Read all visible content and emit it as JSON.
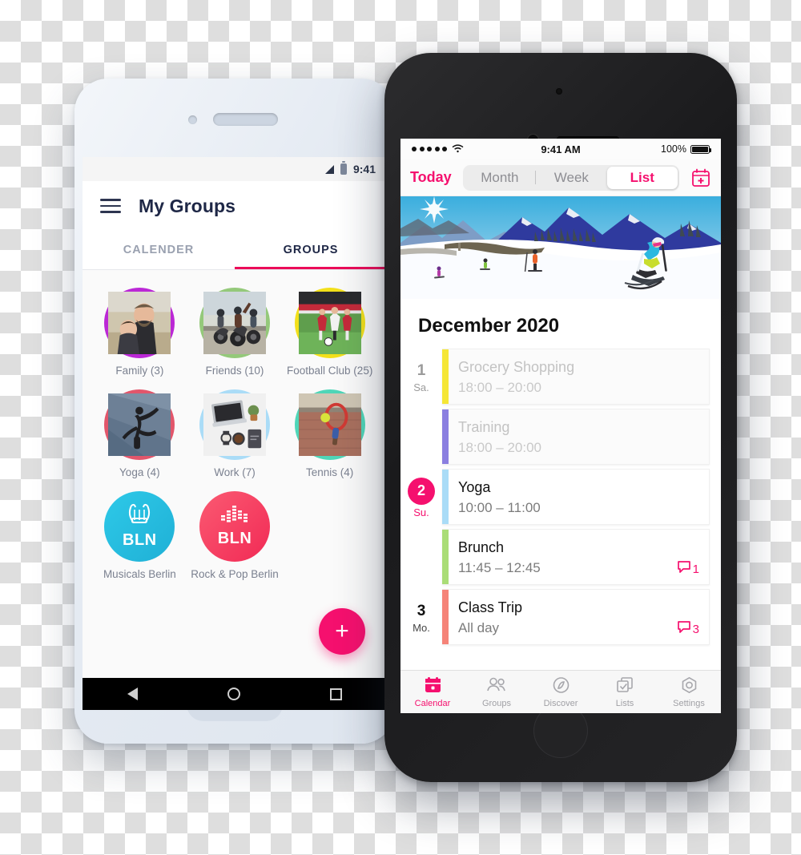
{
  "android": {
    "status": {
      "time": "9:41"
    },
    "header": {
      "title": "My Groups",
      "menu_icon": "hamburger-menu-icon"
    },
    "tabs": [
      {
        "label": "CALENDER",
        "active": false
      },
      {
        "label": "GROUPS",
        "active": true
      }
    ],
    "groups": [
      {
        "label": "Family (3)",
        "ring": "#bb28d6",
        "kind": "photo",
        "photo": "family-portrait"
      },
      {
        "label": "Friends (10)",
        "ring": "#94c97a",
        "kind": "photo",
        "photo": "motorcycle-riders"
      },
      {
        "label": "Football Club (25)",
        "ring": "#f3e01a",
        "kind": "photo",
        "photo": "soccer-match"
      },
      {
        "label": "Yoga (4)",
        "ring": "#e2566b",
        "kind": "photo",
        "photo": "yoga-pose"
      },
      {
        "label": "Work (7)",
        "ring": "#aadcf7",
        "kind": "photo",
        "photo": "desk-laptop"
      },
      {
        "label": "Tennis (4)",
        "ring": "#4fd6b8",
        "kind": "photo",
        "photo": "tennis-racket"
      },
      {
        "label": "Musicals Berlin",
        "fill": "#27bfe0",
        "kind": "logo",
        "logo_icon": "lyre-icon",
        "logo_text": "BLN"
      },
      {
        "label": "Rock & Pop Berlin",
        "fill": "#f43f63",
        "kind": "logo",
        "logo_icon": "equalizer-icon",
        "logo_text": "BLN"
      }
    ],
    "fab": {
      "label": "+",
      "color": "#f5106e"
    },
    "navbar": {
      "back": "back-triangle-icon",
      "home": "home-circle-icon",
      "recents": "recents-square-icon"
    }
  },
  "ios": {
    "status": {
      "carrier_dots": 5,
      "wifi": "wifi-icon",
      "time": "9:41 AM",
      "battery_percent": "100%"
    },
    "toolbar": {
      "today_label": "Today",
      "segments": [
        {
          "label": "Month",
          "selected": false
        },
        {
          "label": "Week",
          "selected": false
        },
        {
          "label": "List",
          "selected": true
        }
      ],
      "add_icon": "calendar-plus-icon"
    },
    "hero": {
      "alt": "ski-slope-illustration"
    },
    "month_title": "December 2020",
    "events": [
      {
        "day_num": "1",
        "day_week": "Sa.",
        "day_style": "muted",
        "show_date": true,
        "title": "Grocery Shopping",
        "time": "18:00 – 20:00",
        "bar_color": "#f5e636",
        "past": true,
        "comments": ""
      },
      {
        "day_num": "",
        "day_week": "",
        "day_style": "muted",
        "show_date": false,
        "title": "Training",
        "time": "18:00 – 20:00",
        "bar_color": "#8b7fe0",
        "past": true,
        "comments": ""
      },
      {
        "day_num": "2",
        "day_week": "Su.",
        "day_style": "today",
        "show_date": true,
        "title": "Yoga",
        "time": "10:00 – 11:00",
        "bar_color": "#aadcf7",
        "past": false,
        "comments": ""
      },
      {
        "day_num": "",
        "day_week": "",
        "day_style": "muted",
        "show_date": false,
        "title": "Brunch",
        "time": "11:45 – 12:45",
        "bar_color": "#aadd77",
        "past": false,
        "comments": "1"
      },
      {
        "day_num": "3",
        "day_week": "Mo.",
        "day_style": "strong",
        "show_date": true,
        "title": "Class Trip",
        "time": "All day",
        "bar_color": "#f58378",
        "past": false,
        "comments": "3"
      }
    ],
    "tabbar": [
      {
        "label": "Calendar",
        "icon": "calendar-icon",
        "active": true
      },
      {
        "label": "Groups",
        "icon": "people-icon",
        "active": false
      },
      {
        "label": "Discover",
        "icon": "compass-icon",
        "active": false
      },
      {
        "label": "Lists",
        "icon": "checklist-icon",
        "active": false
      },
      {
        "label": "Settings",
        "icon": "gear-hex-icon",
        "active": false
      }
    ]
  },
  "colors": {
    "accent_pink": "#f5106e",
    "android_accent": "#ec0c59"
  }
}
